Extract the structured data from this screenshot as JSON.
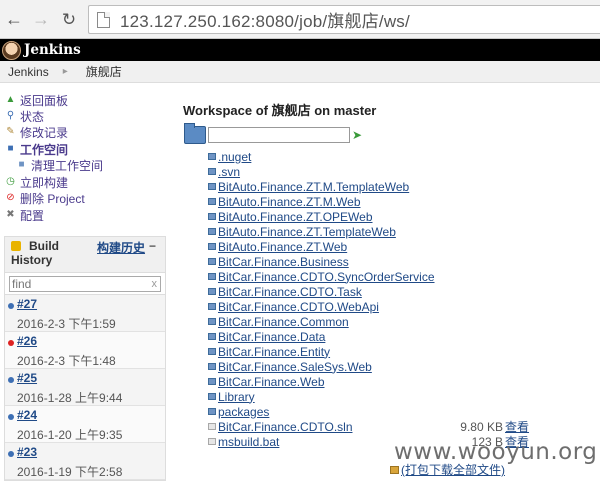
{
  "browser": {
    "url": "123.127.250.162:8080/job/旗舰店/ws/"
  },
  "header": {
    "title": "Jenkins"
  },
  "breadcrumbs": [
    "Jenkins",
    "旗舰店"
  ],
  "tasks": [
    {
      "label": "返回面板",
      "icon": "up-arrow-icon"
    },
    {
      "label": "状态",
      "icon": "search-icon"
    },
    {
      "label": "修改记录",
      "icon": "notepad-icon"
    },
    {
      "label": "工作空间",
      "icon": "folder-icon"
    },
    {
      "label": "清理工作空间",
      "icon": "folder-delete-icon"
    },
    {
      "label": "立即构建",
      "icon": "clock-icon"
    },
    {
      "label": "删除 Project",
      "icon": "no-entry-icon"
    },
    {
      "label": "配置",
      "icon": "wrench-icon"
    }
  ],
  "build_history": {
    "title": "Build History",
    "trend_label": "构建历史",
    "collapse_label": "−",
    "filter_placeholder": "find",
    "clear_label": "x",
    "builds": [
      {
        "number": "#27",
        "date": "2016-2-3 下午1:59",
        "status": "blue"
      },
      {
        "number": "#26",
        "date": "2016-2-3 下午1:48",
        "status": "red"
      },
      {
        "number": "#25",
        "date": "2016-1-28 上午9:44",
        "status": "blue"
      },
      {
        "number": "#24",
        "date": "2016-1-20 上午9:35",
        "status": "blue"
      },
      {
        "number": "#23",
        "date": "2016-1-19 下午2:58",
        "status": "blue"
      }
    ]
  },
  "workspace": {
    "title": "Workspace of 旗舰店 on master",
    "path_value": "",
    "entries": [
      {
        "name": ".nuget",
        "type": "folder"
      },
      {
        "name": ".svn",
        "type": "folder"
      },
      {
        "name": "BitAuto.Finance.ZT.M.TemplateWeb",
        "type": "folder"
      },
      {
        "name": "BitAuto.Finance.ZT.M.Web",
        "type": "folder"
      },
      {
        "name": "BitAuto.Finance.ZT.OPEWeb",
        "type": "folder"
      },
      {
        "name": "BitAuto.Finance.ZT.TemplateWeb",
        "type": "folder"
      },
      {
        "name": "BitAuto.Finance.ZT.Web",
        "type": "folder"
      },
      {
        "name": "BitCar.Finance.Business",
        "type": "folder"
      },
      {
        "name": "BitCar.Finance.CDTO.SyncOrderService",
        "type": "folder"
      },
      {
        "name": "BitCar.Finance.CDTO.Task",
        "type": "folder"
      },
      {
        "name": "BitCar.Finance.CDTO.WebApi",
        "type": "folder"
      },
      {
        "name": "BitCar.Finance.Common",
        "type": "folder"
      },
      {
        "name": "BitCar.Finance.Data",
        "type": "folder"
      },
      {
        "name": "BitCar.Finance.Entity",
        "type": "folder"
      },
      {
        "name": "BitCar.Finance.SaleSys.Web",
        "type": "folder"
      },
      {
        "name": "BitCar.Finance.Web",
        "type": "folder"
      },
      {
        "name": "Library",
        "type": "folder"
      },
      {
        "name": "packages",
        "type": "folder"
      },
      {
        "name": "BitCar.Finance.CDTO.sln",
        "type": "file",
        "size": "9.80 KB",
        "view": "查看"
      },
      {
        "name": "msbuild.bat",
        "type": "file",
        "size": "123 B",
        "view": "查看"
      }
    ],
    "zip_label": "(打包下载全部文件)"
  },
  "watermark": "www.wooyun.org"
}
